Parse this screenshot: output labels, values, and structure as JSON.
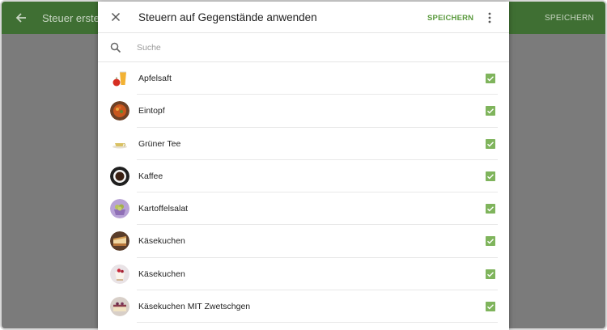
{
  "background": {
    "title": "Steuer erstellen",
    "save_label": "SPEICHERN"
  },
  "dialog": {
    "title": "Steuern auf Gegenstände anwenden",
    "save_label": "SPEICHERN",
    "search_placeholder": "Suche",
    "items": [
      {
        "label": "Apfelsaft",
        "checked": true,
        "icon": "juice-image"
      },
      {
        "label": "Eintopf",
        "checked": true,
        "icon": "stew-image"
      },
      {
        "label": "Grüner Tee",
        "checked": true,
        "icon": "tea-image"
      },
      {
        "label": "Kaffee",
        "checked": true,
        "icon": "coffee-image"
      },
      {
        "label": "Kartoffelsalat",
        "checked": true,
        "icon": "potato-salad-image"
      },
      {
        "label": "Käsekuchen",
        "checked": true,
        "icon": "cheesecake-image"
      },
      {
        "label": "Käsekuchen",
        "checked": true,
        "icon": "cheesecake-image"
      },
      {
        "label": "Käsekuchen MIT Zwetschgen",
        "checked": true,
        "icon": "plum-cheesecake-image"
      }
    ]
  },
  "colors": {
    "toolbar": "#3f6f33",
    "accent": "#5a9a3d",
    "checkbox": "#7fb45c",
    "scrim": "#7b7b7b"
  }
}
